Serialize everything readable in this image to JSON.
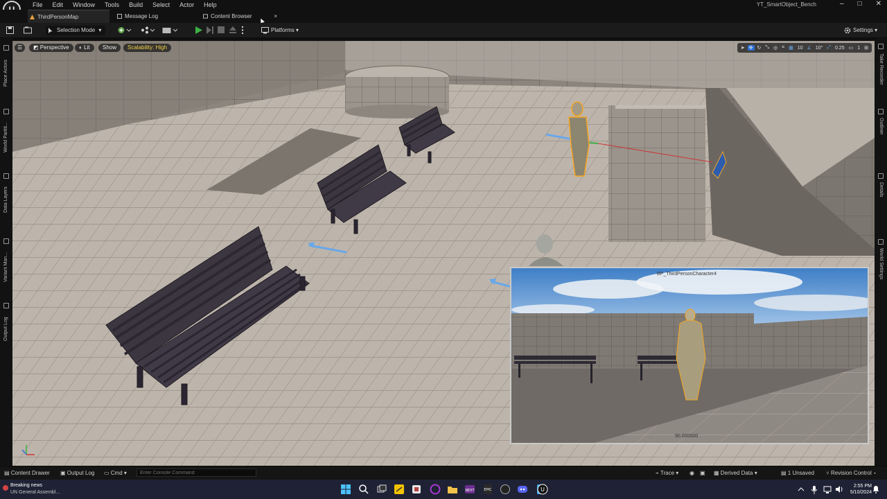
{
  "menubar": {
    "logo_glyph": "U",
    "items": [
      "File",
      "Edit",
      "Window",
      "Tools",
      "Build",
      "Select",
      "Actor",
      "Help"
    ],
    "project_name": "YT_SmartObject_Bench",
    "minimize_glyph": "–",
    "maximize_glyph": "□",
    "close_glyph": "✕"
  },
  "tabs": [
    {
      "label": "ThirdPersonMap",
      "icon": "level-icon"
    },
    {
      "label": "Message Log",
      "icon": "log-icon"
    },
    {
      "label": "Content Browser",
      "icon": "content-browser-icon"
    }
  ],
  "tab_close_glyph": "×",
  "toolbar": {
    "selection_mode": "Selection Mode",
    "platforms": "Platforms",
    "settings": "Settings"
  },
  "left_panels": [
    "Place Actors",
    "World Partiti...",
    "Data Layers",
    "Variant Man...",
    "Output Log"
  ],
  "right_panels": [
    "Take Recorder",
    "Outliner",
    "Details",
    "World Settings"
  ],
  "viewport": {
    "perspective": "Perspective",
    "lit": "Lit",
    "show": "Show",
    "scalability": "Scalability: High",
    "grid_snap": "10",
    "rotation_snap": "10°",
    "scale_snap": "0.25",
    "camera_speed": "1"
  },
  "preview": {
    "title": "BP_ThirdPersonCharacter4",
    "value": "90.000000"
  },
  "statusbar": {
    "content_drawer": "Content Drawer",
    "output_log": "Output Log",
    "cmd": "Cmd",
    "console_placeholder": "Enter Console Command",
    "trace": "Trace",
    "derived_data": "Derived Data",
    "unsaved": "1 Unsaved",
    "revision_control": "Revision Control"
  },
  "taskbar": {
    "news_title": "Breaking news",
    "news_subtitle": "UN General Assembl...",
    "time": "2:55 PM",
    "date": "5/10/2024"
  },
  "colors": {
    "accent_play": "#3cb043",
    "scalability": "#f2d14a",
    "selection_orange": "#f5a623"
  }
}
